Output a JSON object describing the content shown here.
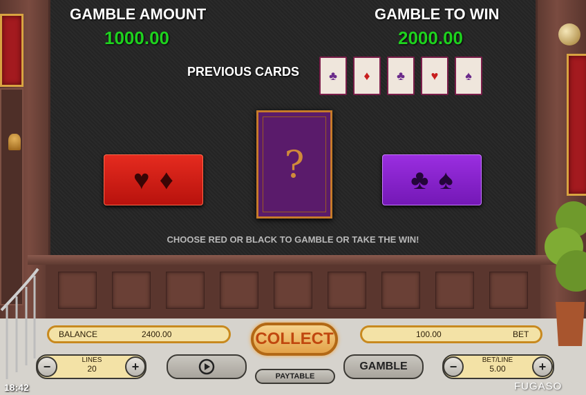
{
  "header": {
    "gamble_amount_label": "GAMBLE AMOUNT",
    "gamble_amount_value": "1000.00",
    "gamble_to_win_label": "GAMBLE TO WIN",
    "gamble_to_win_value": "2000.00",
    "previous_cards_label": "PREVIOUS CARDS"
  },
  "previous_cards": [
    {
      "suit": "♣",
      "color": "#6a2a8a"
    },
    {
      "suit": "♦",
      "color": "#c81e1e"
    },
    {
      "suit": "♣",
      "color": "#6a2a8a"
    },
    {
      "suit": "♥",
      "color": "#c81e1e"
    },
    {
      "suit": "♠",
      "color": "#6a2a8a"
    }
  ],
  "choices": {
    "red_suits": [
      "♥",
      "♦"
    ],
    "black_suits": [
      "♣",
      "♠"
    ],
    "mystery_symbol": "?"
  },
  "hint": "CHOOSE RED OR BLACK TO GAMBLE OR TAKE THE WIN!",
  "controls": {
    "balance_label": "BALANCE",
    "balance_value": "2400.00",
    "collect_label": "COLLECT",
    "bet_value": "100.00",
    "bet_label": "BET",
    "lines_label": "LINES",
    "lines_value": "20",
    "minus": "−",
    "plus": "+",
    "paytable_label": "PAYTABLE",
    "gamble_label": "GAMBLE",
    "betline_label": "BET/LINE",
    "betline_value": "5.00"
  },
  "clock": "18:42",
  "brand": "FUGASO",
  "colors": {
    "amount_green": "#1ed11e",
    "red_choice": "#d21b14",
    "black_choice": "#8a25cf",
    "collect_text": "#c0470e"
  }
}
